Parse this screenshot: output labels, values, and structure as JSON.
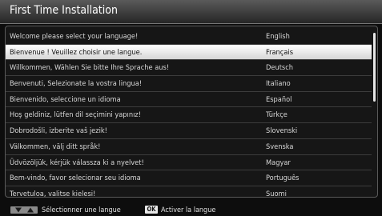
{
  "header": {
    "title": "First Time Installation"
  },
  "languages": [
    {
      "greeting": "Welcome please select your language!",
      "name": "English"
    },
    {
      "greeting": "Bienvenue ! Veuillez choisir une langue.",
      "name": "Français"
    },
    {
      "greeting": "Willkommen, Wählen Sie bitte Ihre Sprache aus!",
      "name": "Deutsch"
    },
    {
      "greeting": "Benvenuti, Selezionate la vostra lingua!",
      "name": "Italiano"
    },
    {
      "greeting": "Bienvenido, seleccione un idioma",
      "name": "Español"
    },
    {
      "greeting": "Hoş geldiniz, lütfen dil seçimini yapınız!",
      "name": "Türkçe"
    },
    {
      "greeting": "Dobrodošli, izberite vaš jezik!",
      "name": "Slovenski"
    },
    {
      "greeting": "Välkommen, välj ditt språk!",
      "name": "Svenska"
    },
    {
      "greeting": "Üdvözöljük, kérjük válassza ki a nyelvet!",
      "name": "Magyar"
    },
    {
      "greeting": "Bem-vindo, favor selecionar seu idioma",
      "name": "Português"
    },
    {
      "greeting": "Tervetuloa, valitse kielesi!",
      "name": "Suomi"
    }
  ],
  "selected_index": 1,
  "footer": {
    "navigate_hint": "Sélectionner une langue",
    "ok_key_label": "OK",
    "ok_hint": "Activer la langue"
  }
}
